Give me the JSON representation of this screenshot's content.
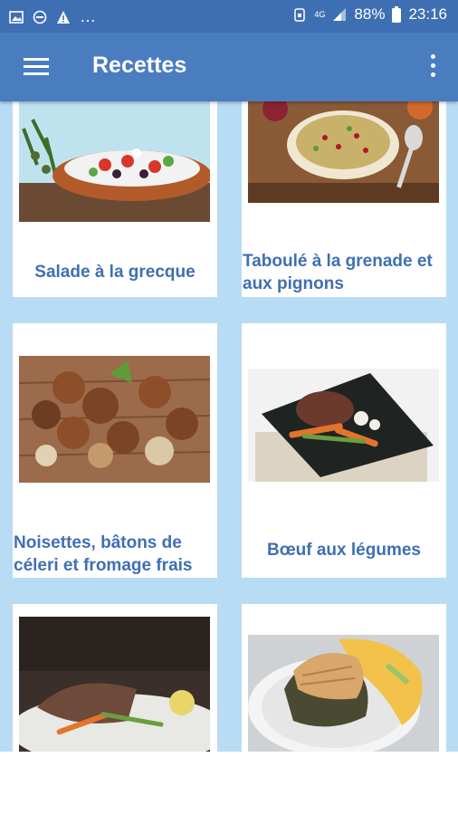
{
  "status": {
    "battery": "88%",
    "time": "23:16",
    "network": "4G"
  },
  "appbar": {
    "title": "Recettes"
  },
  "recipes": [
    {
      "title": "Salade à la grecque"
    },
    {
      "title": "Taboulé à la grenade et aux pignons"
    },
    {
      "title": "Noisettes, bâtons de céleri et fromage frais"
    },
    {
      "title": "Bœuf aux légumes"
    },
    {
      "title": ""
    },
    {
      "title": ""
    }
  ],
  "colors": {
    "statusbar": "#3f6fb3",
    "appbar": "#4a7dc0",
    "background": "#b9dcf5",
    "label": "#3f6fb3"
  }
}
